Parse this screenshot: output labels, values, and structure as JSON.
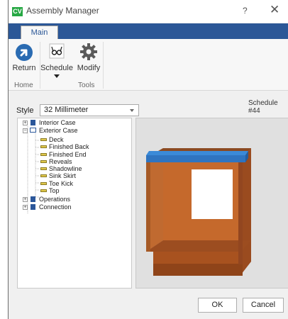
{
  "window": {
    "title": "Assembly Manager",
    "logo": "CV",
    "help": "?",
    "close": "✕"
  },
  "ribbon": {
    "tab": "Main",
    "buttons": {
      "return": "Return",
      "schedule": "Schedule",
      "modify": "Modify"
    },
    "groups": {
      "home": "Home",
      "tools": "Tools"
    }
  },
  "style": {
    "label": "Style",
    "value": "32 Millimeter"
  },
  "schedule_number": "Schedule #44",
  "tree": {
    "interior_case": "Interior Case",
    "exterior_case": "Exterior Case",
    "items": [
      "Deck",
      "Finished Back",
      "Finished End",
      "Reveals",
      "Shadowline",
      "Sink Skirt",
      "Toe Kick",
      "Top"
    ],
    "operations": "Operations",
    "connection": "Connection"
  },
  "buttons": {
    "ok": "OK",
    "cancel": "Cancel"
  },
  "colors": {
    "accent": "#2b5797",
    "cabinet": "#a34f1f",
    "highlight": "#2f74c0"
  }
}
